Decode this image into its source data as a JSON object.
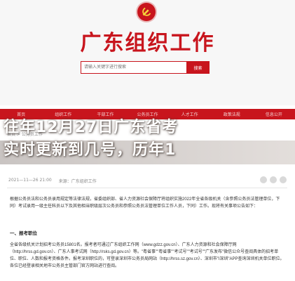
{
  "header": {
    "site_title": "广东组织工作",
    "search_placeholder": "请输入关键字进行搜索",
    "search_label": "搜索",
    "emblem_icon": "party-emblem-icon",
    "accent_color": "#c8151d"
  },
  "nav": {
    "items": [
      "首页",
      "组织工作",
      "干部工作",
      "公务员工作",
      "人才工作",
      "政策法规",
      "信息公开"
    ]
  },
  "breadcrumb": "首页 > 公务员工作",
  "overlay_title": {
    "line1": "往年12月27日广东省考",
    "line2": "实时更新到几号，历年1"
  },
  "meta": {
    "date": "2021—11—26 21:00",
    "source": "来源：广东组织工作"
  },
  "article": {
    "para1": "根据公务员法和公务员录用规定等法律法规，省委组织部、省人力资源社会保障厅将组织实施2022年全省各级机关（含参照公务员法管理单位，下同）考试录用一级主任科员以下及其他相当职级层次公务员和参照公务员法管理单位工作人员，下同）工作。现将有关事项公告如下：",
    "section1": "一、报考职位",
    "para2": "全省各级机关计划招考公务员15801名。报考者可通过广东组织工作网（www.gdzz.gov.cn）、广东人力资源和社会保障厅网（http://hrss.gd.gov.cn）、广东人事考试网（http://rsks.gd.gov.cn）等。\"粤省事\"\"粤省事\"\"考试号\"\"考试号\"\"广东发布\"微信公众号查阅具体的招考单位、职位、人数和报考资格条件。报考深圳职位的，可登录深圳市公务员局网站（http://hrss.sz.gov.cn）、深圳市\"i深圳\"APP查询深圳机关单位职位。各位已经登录相关地市公务员主管部门官方网站进行查阅。"
  }
}
